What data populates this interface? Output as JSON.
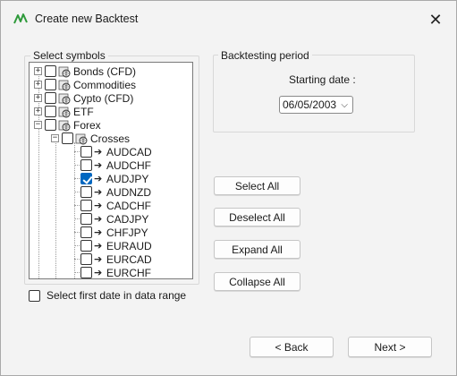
{
  "window": {
    "title": "Create new Backtest",
    "close_symbol": "✕"
  },
  "symbols_group": {
    "label": "Select symbols"
  },
  "tree": {
    "categories": [
      {
        "label": "Bonds (CFD)",
        "expander": "+"
      },
      {
        "label": "Commodities",
        "expander": "+"
      },
      {
        "label": "Cypto (CFD)",
        "expander": "+"
      },
      {
        "label": "ETF",
        "expander": "+"
      },
      {
        "label": "Forex",
        "expander": "−"
      }
    ],
    "subgroup": {
      "label": "Crosses",
      "expander": "−"
    },
    "symbols": [
      {
        "label": "AUDCAD",
        "checked": false
      },
      {
        "label": "AUDCHF",
        "checked": false
      },
      {
        "label": "AUDJPY",
        "checked": true
      },
      {
        "label": "AUDNZD",
        "checked": false
      },
      {
        "label": "CADCHF",
        "checked": false
      },
      {
        "label": "CADJPY",
        "checked": false
      },
      {
        "label": "CHFJPY",
        "checked": false
      },
      {
        "label": "EURAUD",
        "checked": false
      },
      {
        "label": "EURCAD",
        "checked": false
      },
      {
        "label": "EURCHF",
        "checked": false
      }
    ],
    "arrow_glyph": "➔"
  },
  "first_date_option": {
    "label": "Select first date in data range",
    "checked": false
  },
  "period_group": {
    "label": "Backtesting period",
    "starting_date_label": "Starting date :",
    "starting_date_value": "06/05/2003"
  },
  "buttons": {
    "select_all": "Select All",
    "deselect_all": "Deselect All",
    "expand_all": "Expand All",
    "collapse_all": "Collapse All",
    "back": "< Back",
    "next": "Next >"
  },
  "colors": {
    "accent": "#0067c0",
    "app_icon": "#2e9a3a"
  },
  "icons": {
    "app": "green-chart-line-icon",
    "folder": "globe-folder-icon",
    "symbol": "arrow-right-icon"
  }
}
